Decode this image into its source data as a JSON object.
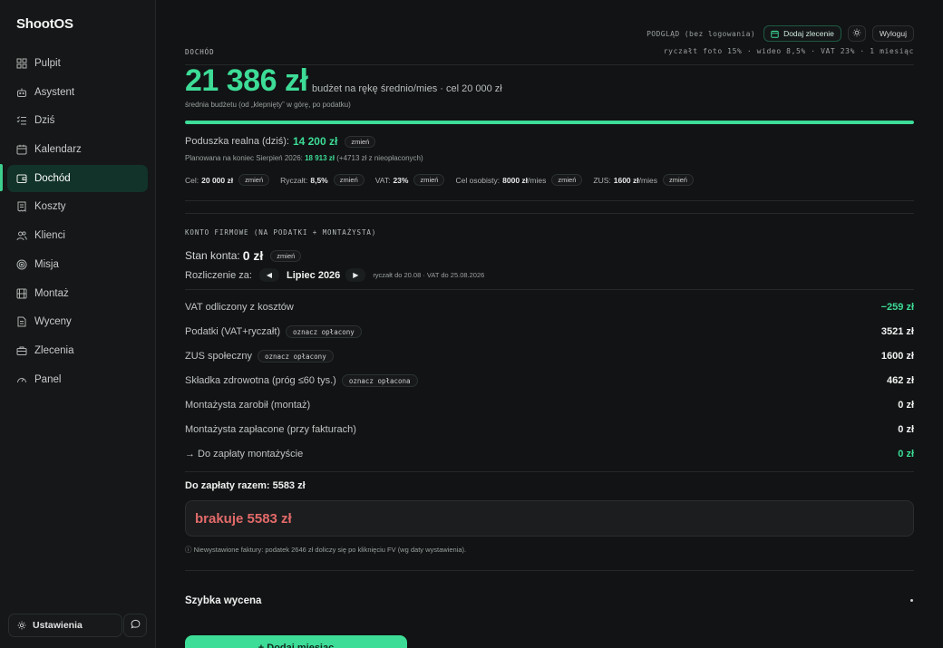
{
  "app": {
    "name": "ShootOS"
  },
  "sidebar": {
    "items": [
      {
        "label": "Pulpit",
        "icon": "grid-icon"
      },
      {
        "label": "Asystent",
        "icon": "bot-icon"
      },
      {
        "label": "Dziś",
        "icon": "checklist-icon"
      },
      {
        "label": "Kalendarz",
        "icon": "calendar-icon"
      },
      {
        "label": "Dochód",
        "icon": "wallet-icon",
        "active": true
      },
      {
        "label": "Koszty",
        "icon": "receipt-icon"
      },
      {
        "label": "Klienci",
        "icon": "users-icon"
      },
      {
        "label": "Misja",
        "icon": "target-icon"
      },
      {
        "label": "Montaż",
        "icon": "film-icon"
      },
      {
        "label": "Wyceny",
        "icon": "document-icon"
      },
      {
        "label": "Zlecenia",
        "icon": "briefcase-icon"
      },
      {
        "label": "Panel",
        "icon": "gauge-icon"
      }
    ],
    "settings_label": "Ustawienia"
  },
  "header": {
    "preview_label": "PODGLĄD (bez logowania)",
    "add_order_label": "Dodaj zlecenie",
    "logout_label": "Wyloguj",
    "rates_line": "ryczałt foto 15% · wideo 8,5% · VAT 23% · 1 miesiąc"
  },
  "income": {
    "section_label": "DOCHÓD",
    "amount": "21 386 zł",
    "amount_caption": "budżet na rękę średnio/mies · cel 20 000 zł",
    "sub_caption": "średnia budżetu (od „klepnięty” w górę, po podatku)",
    "progress_fraction": 1.0,
    "cushion_label": "Poduszka realna (dziś):",
    "cushion_value": "14 200 zł",
    "change_label": "zmień",
    "planned_prefix": "Planowana na koniec Sierpień 2026:",
    "planned_value": "18 913 zł",
    "planned_suffix": "(+4713 zł z nieopłaconych)",
    "params": [
      {
        "label": "Cel:",
        "value": "20 000 zł"
      },
      {
        "label": "Ryczałt:",
        "value": "8,5%"
      },
      {
        "label": "VAT:",
        "value": "23%"
      },
      {
        "label": "Cel osobisty:",
        "value": "8000 zł",
        "suffix": "/mies"
      },
      {
        "label": "ZUS:",
        "value": "1600 zł",
        "suffix": "/mies"
      }
    ]
  },
  "company": {
    "section_label": "KONTO FIRMOWE (NA PODATKI + MONTAŻYSTA)",
    "balance_label": "Stan konta:",
    "balance_value": "0 zł",
    "settle_label": "Rozliczenie za:",
    "month": "Lipiec 2026",
    "deadline": "ryczałt do 20.08 · VAT do 25.08.2026",
    "rows": [
      {
        "label": "VAT odliczony z kosztów",
        "amount": "−259 zł",
        "green": true
      },
      {
        "label": "Podatki (VAT+ryczałt)",
        "pill": "oznacz opłacony",
        "amount": "3521 zł"
      },
      {
        "label": "ZUS społeczny",
        "pill": "oznacz opłacony",
        "amount": "1600 zł"
      },
      {
        "label": "Składka zdrowotna (próg ≤60 tys.)",
        "pill": "oznacz opłacona",
        "amount": "462 zł"
      },
      {
        "label": "Montażysta zarobił (montaż)",
        "amount": "0 zł"
      },
      {
        "label": "Montażysta zapłacone (przy fakturach)",
        "amount": "0 zł"
      },
      {
        "label": "→ Do zapłaty montażyście",
        "amount": "0 zł",
        "green": true
      }
    ],
    "total_label": "Do zapłaty razem: 5583 zł",
    "missing_label": "brakuje 5583 zł",
    "note": "ⓘ Niewystawione faktury: podatek 2646 zł doliczy się po kliknięciu FV (wg daty wystawienia)."
  },
  "quick": {
    "title": "Szybka wycena",
    "add_button": "+ Dodaj miesiąc"
  },
  "colors": {
    "accent": "#3ddc97",
    "danger": "#e36a6a",
    "background": "#111314"
  }
}
